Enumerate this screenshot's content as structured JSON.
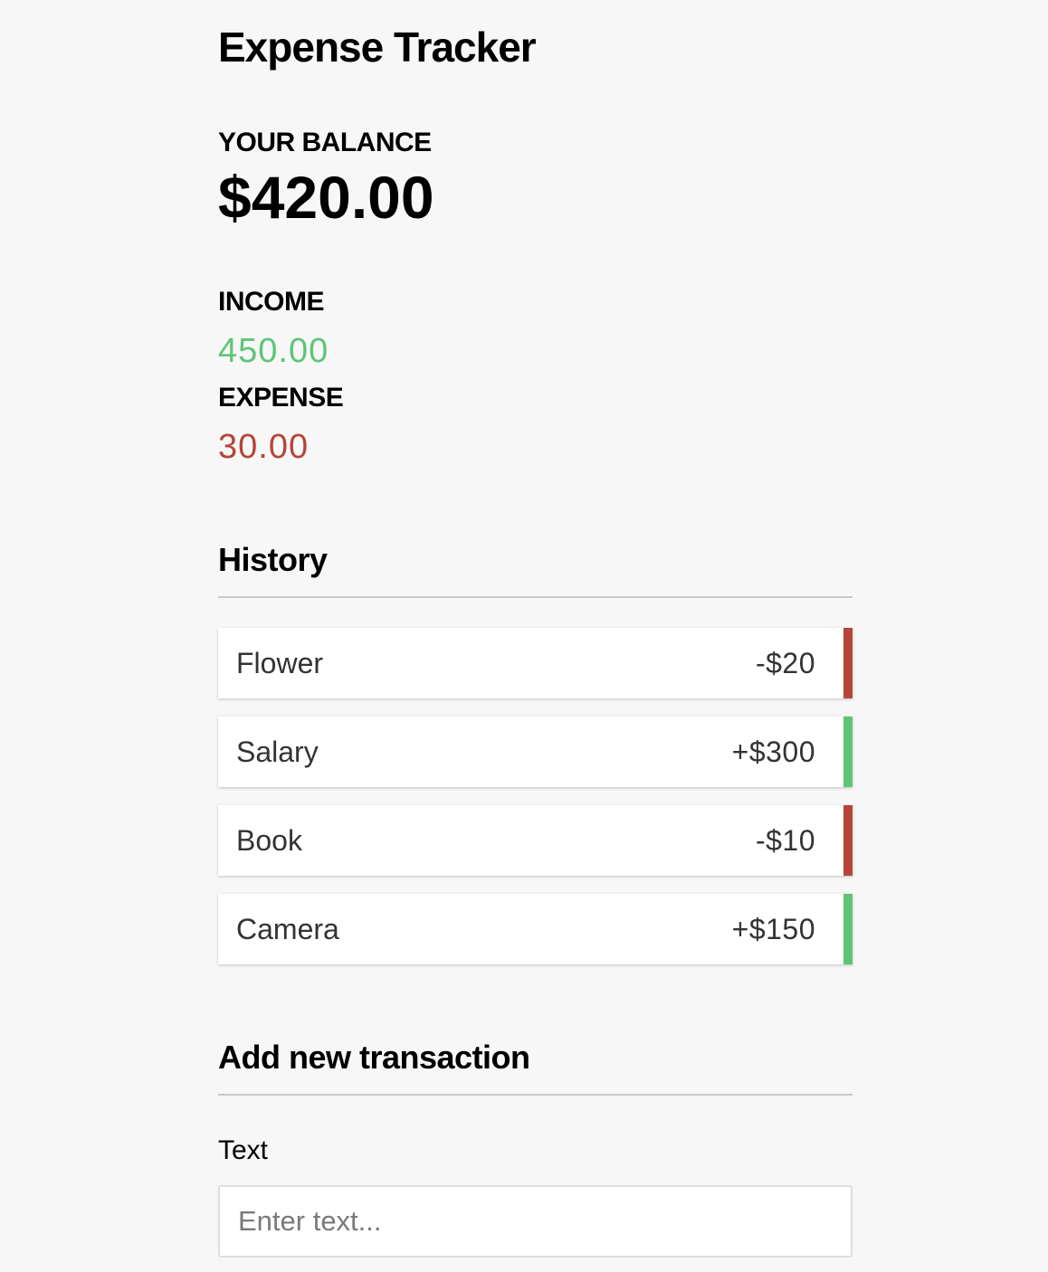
{
  "app": {
    "title": "Expense Tracker"
  },
  "balance": {
    "label": "YOUR BALANCE",
    "value": "$420.00"
  },
  "summary": {
    "income_label": "INCOME",
    "income_value": "450.00",
    "expense_label": "EXPENSE",
    "expense_value": "30.00"
  },
  "history": {
    "title": "History",
    "items": [
      {
        "text": "Flower",
        "amount": "-$20",
        "type": "minus"
      },
      {
        "text": "Salary",
        "amount": "+$300",
        "type": "plus"
      },
      {
        "text": "Book",
        "amount": "-$10",
        "type": "minus"
      },
      {
        "text": "Camera",
        "amount": "+$150",
        "type": "plus"
      }
    ]
  },
  "add_transaction": {
    "title": "Add new transaction",
    "text_label": "Text",
    "text_placeholder": "Enter text...",
    "text_value": ""
  },
  "colors": {
    "background": "#f7f7f7",
    "income": "#5ec578",
    "expense": "#b5453a"
  }
}
